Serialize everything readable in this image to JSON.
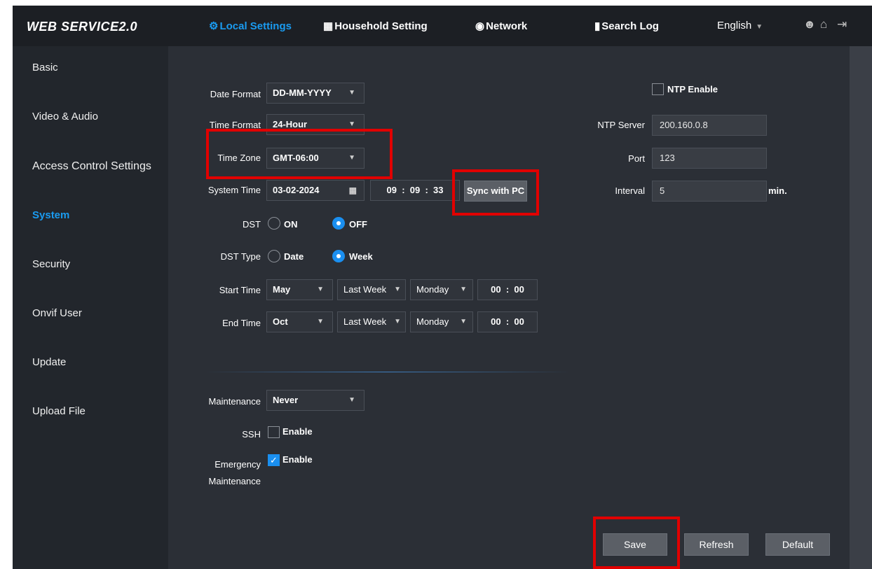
{
  "header": {
    "brand": "WEB SERVICE2.0",
    "nav": [
      {
        "label": "Local Settings",
        "icon": "gear-icon",
        "active": true
      },
      {
        "label": "Household Setting",
        "icon": "building-icon",
        "active": false
      },
      {
        "label": "Network",
        "icon": "globe-icon",
        "active": false
      },
      {
        "label": "Search Log",
        "icon": "document-icon",
        "active": false
      }
    ],
    "language": "English",
    "icons": [
      "user-icon",
      "home-icon",
      "logout-icon"
    ]
  },
  "sidebar": {
    "items": [
      {
        "label": "Basic"
      },
      {
        "label": "Video & Audio"
      },
      {
        "label": "Access Control Settings"
      },
      {
        "label": "System",
        "active": true
      },
      {
        "label": "Security"
      },
      {
        "label": "Onvif User"
      },
      {
        "label": "Update"
      },
      {
        "label": "Upload File"
      }
    ]
  },
  "form": {
    "date_format": {
      "label": "Date Format",
      "value": "DD-MM-YYYY"
    },
    "time_format": {
      "label": "Time Format",
      "value": "24-Hour"
    },
    "time_zone": {
      "label": "Time Zone",
      "value": "GMT-06:00"
    },
    "system_time": {
      "label": "System Time",
      "date": "03-02-2024",
      "hh": "09",
      "mm": "09",
      "ss": "33",
      "sync_label": "Sync with PC"
    },
    "dst": {
      "label": "DST",
      "on_label": "ON",
      "off_label": "OFF",
      "selected": "OFF"
    },
    "dst_type": {
      "label": "DST Type",
      "date_label": "Date",
      "week_label": "Week",
      "selected": "Week"
    },
    "start_time": {
      "label": "Start Time",
      "month": "May",
      "week": "Last Week",
      "day": "Monday",
      "hh": "00",
      "mm": "00"
    },
    "end_time": {
      "label": "End Time",
      "month": "Oct",
      "week": "Last Week",
      "day": "Monday",
      "hh": "00",
      "mm": "00"
    },
    "maintenance": {
      "label": "Maintenance",
      "value": "Never"
    },
    "ssh": {
      "label": "SSH",
      "enable_label": "Enable",
      "checked": false
    },
    "emergency": {
      "label_line1": "Emergency",
      "label_line2": "Maintenance",
      "enable_label": "Enable",
      "checked": true
    }
  },
  "ntp": {
    "enable_label": "NTP Enable",
    "enabled": false,
    "server_label": "NTP Server",
    "server": "200.160.0.8",
    "port_label": "Port",
    "port": "123",
    "interval_label": "Interval",
    "interval": "5",
    "interval_unit": "min."
  },
  "buttons": {
    "save": "Save",
    "refresh": "Refresh",
    "default": "Default"
  },
  "colors": {
    "accent": "#1a9bf0",
    "highlight": "#e10000"
  }
}
